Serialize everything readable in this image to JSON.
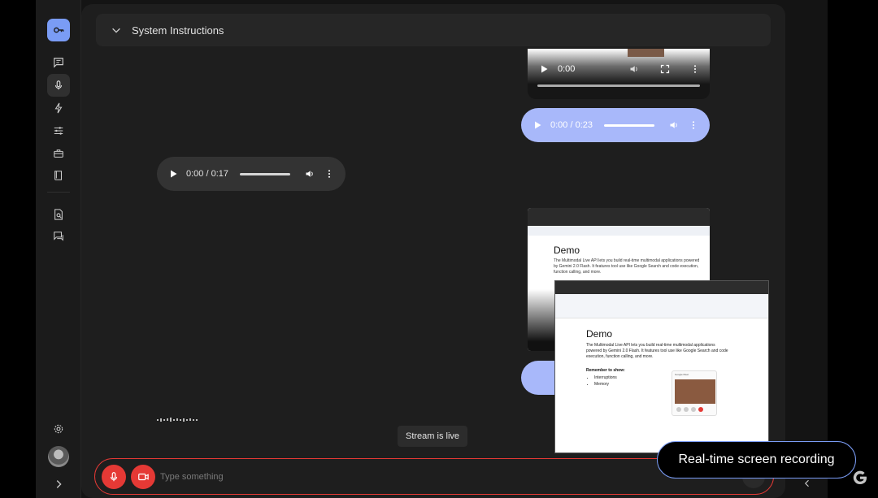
{
  "header": {
    "system_instructions_label": "System Instructions"
  },
  "left_player": {
    "time": "0:00 / 0:17",
    "progress": 0
  },
  "right_player": {
    "time": "0:00 / 0:23",
    "progress": 0
  },
  "video_player": {
    "time": "0:00"
  },
  "doc_back": {
    "heading": "Demo",
    "body": "The Multimodal Live API lets you build real-time multimodal applications powered by Gemini 2.0 Flash. It features tool use like Google Search and code execution, function calling, and more."
  },
  "doc_front": {
    "heading": "Demo",
    "body": "The Multimodal Live API lets you build real-time multimodal applications powered by Gemini 2.0 Flash. It features tool use like Google Search and code execution, function calling, and more.",
    "reminder": "Remember to show:",
    "bullets": [
      "Interruptions",
      "Memory"
    ],
    "meet_title": "Google Meet"
  },
  "status": {
    "stream_label": "Stream is live"
  },
  "input": {
    "placeholder": "Type something"
  },
  "caption": {
    "text": "Real-time screen recording"
  },
  "colors": {
    "accent": "#7a9cf5",
    "record_red": "#e53935",
    "player_blue": "#a8b8fa"
  }
}
